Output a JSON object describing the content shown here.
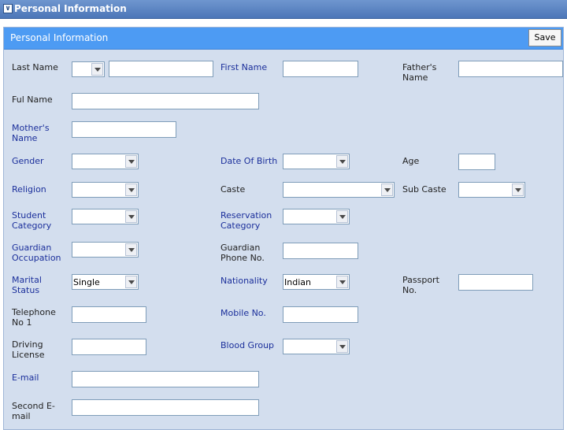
{
  "window": {
    "title": "Personal Information"
  },
  "panel": {
    "title": "Personal Information",
    "save_label": "Save"
  },
  "fields": {
    "last_name": {
      "label": "Last Name",
      "value": ""
    },
    "first_name": {
      "label": "First Name",
      "value": ""
    },
    "fathers_name": {
      "label": "Father's\nName",
      "value": ""
    },
    "full_name": {
      "label": "Ful Name",
      "value": ""
    },
    "mothers_name": {
      "label": "Mother's\nName",
      "value": ""
    },
    "gender": {
      "label": "Gender",
      "value": ""
    },
    "date_of_birth": {
      "label": "Date Of Birth",
      "value": ""
    },
    "age": {
      "label": "Age",
      "value": ""
    },
    "religion": {
      "label": "Religion",
      "value": ""
    },
    "caste": {
      "label": "Caste",
      "value": ""
    },
    "sub_caste": {
      "label": "Sub Caste",
      "value": ""
    },
    "student_category": {
      "label": "Student\nCategory",
      "value": ""
    },
    "reservation_category": {
      "label": "Reservation\nCategory",
      "value": ""
    },
    "guardian_occupation": {
      "label": "Guardian\nOccupation",
      "value": ""
    },
    "guardian_phone": {
      "label": "Guardian\nPhone No.",
      "value": ""
    },
    "marital_status": {
      "label": "Marital\nStatus",
      "value": "Single"
    },
    "nationality": {
      "label": "Nationality",
      "value": "Indian"
    },
    "passport_no": {
      "label": "Passport\nNo.",
      "value": ""
    },
    "telephone_no1": {
      "label": "Telephone\nNo 1",
      "value": ""
    },
    "mobile_no": {
      "label": "Mobile No.",
      "value": ""
    },
    "driving_license": {
      "label": "Driving\nLicense",
      "value": ""
    },
    "blood_group": {
      "label": "Blood Group",
      "value": ""
    },
    "email": {
      "label": "E-mail",
      "value": ""
    },
    "second_email": {
      "label": "Second E-\nmail",
      "value": ""
    }
  },
  "icons": {
    "collapse": "collapse-icon",
    "dropdown": "chevron-down-icon"
  }
}
